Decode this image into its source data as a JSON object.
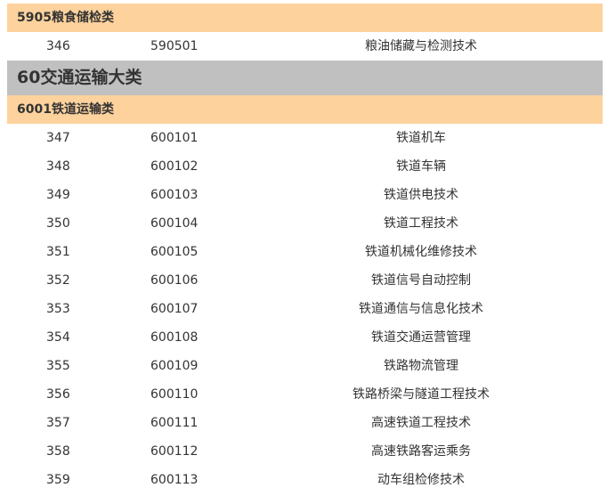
{
  "sections": [
    {
      "type": "subcategory",
      "label": "5905粮食储检类",
      "rows": [
        {
          "num": "346",
          "code": "590501",
          "name": "粮油储藏与检测技术"
        }
      ]
    },
    {
      "type": "category",
      "label": "60交通运输大类"
    },
    {
      "type": "subcategory",
      "label": "6001铁道运输类",
      "rows": [
        {
          "num": "347",
          "code": "600101",
          "name": "铁道机车"
        },
        {
          "num": "348",
          "code": "600102",
          "name": "铁道车辆"
        },
        {
          "num": "349",
          "code": "600103",
          "name": "铁道供电技术"
        },
        {
          "num": "350",
          "code": "600104",
          "name": "铁道工程技术"
        },
        {
          "num": "351",
          "code": "600105",
          "name": "铁道机械化维修技术"
        },
        {
          "num": "352",
          "code": "600106",
          "name": "铁道信号自动控制"
        },
        {
          "num": "353",
          "code": "600107",
          "name": "铁道通信与信息化技术"
        },
        {
          "num": "354",
          "code": "600108",
          "name": "铁道交通运营管理"
        },
        {
          "num": "355",
          "code": "600109",
          "name": "铁路物流管理"
        },
        {
          "num": "356",
          "code": "600110",
          "name": "铁路桥梁与隧道工程技术"
        },
        {
          "num": "357",
          "code": "600111",
          "name": "高速铁道工程技术"
        },
        {
          "num": "358",
          "code": "600112",
          "name": "高速铁路客运乘务"
        },
        {
          "num": "359",
          "code": "600113",
          "name": "动车组检修技术"
        }
      ]
    }
  ]
}
